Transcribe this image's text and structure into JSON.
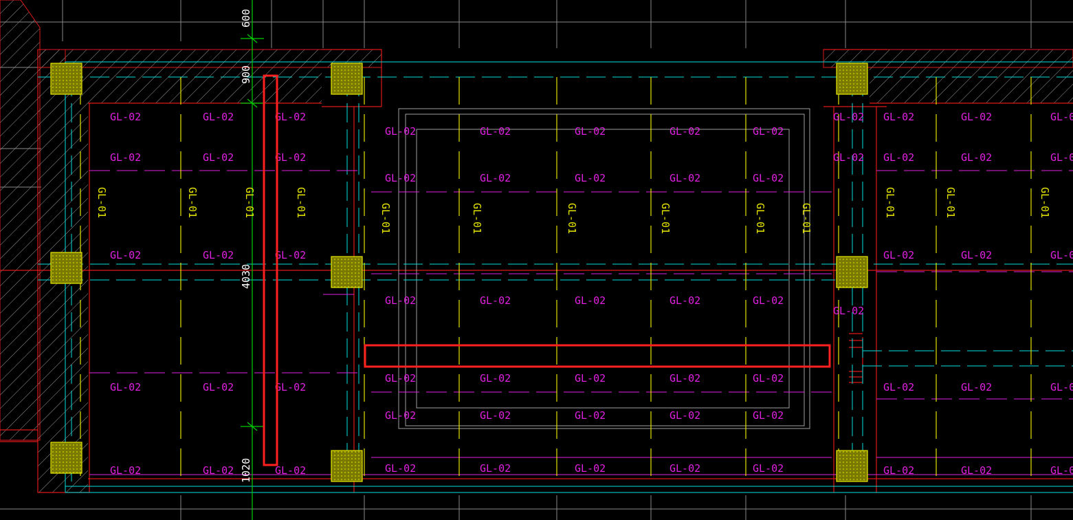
{
  "colors": {
    "background": "#000000",
    "grid": "#8a8a8a",
    "wall_red": "#e01818",
    "beam_label": "#e020e0",
    "beam_line_v": "#e6e600",
    "axis_cyan": "#00e0e0",
    "dim_green": "#00d000",
    "column_fill": "#b4b400",
    "highlight": "#ff2020",
    "dim_text": "#ffffff"
  },
  "beam_labels": {
    "gl02": "GL-02",
    "gl01": "GL-01"
  },
  "dimensions": {
    "top": "600",
    "upper": "900",
    "middle": "4030",
    "bottom": "1020"
  }
}
